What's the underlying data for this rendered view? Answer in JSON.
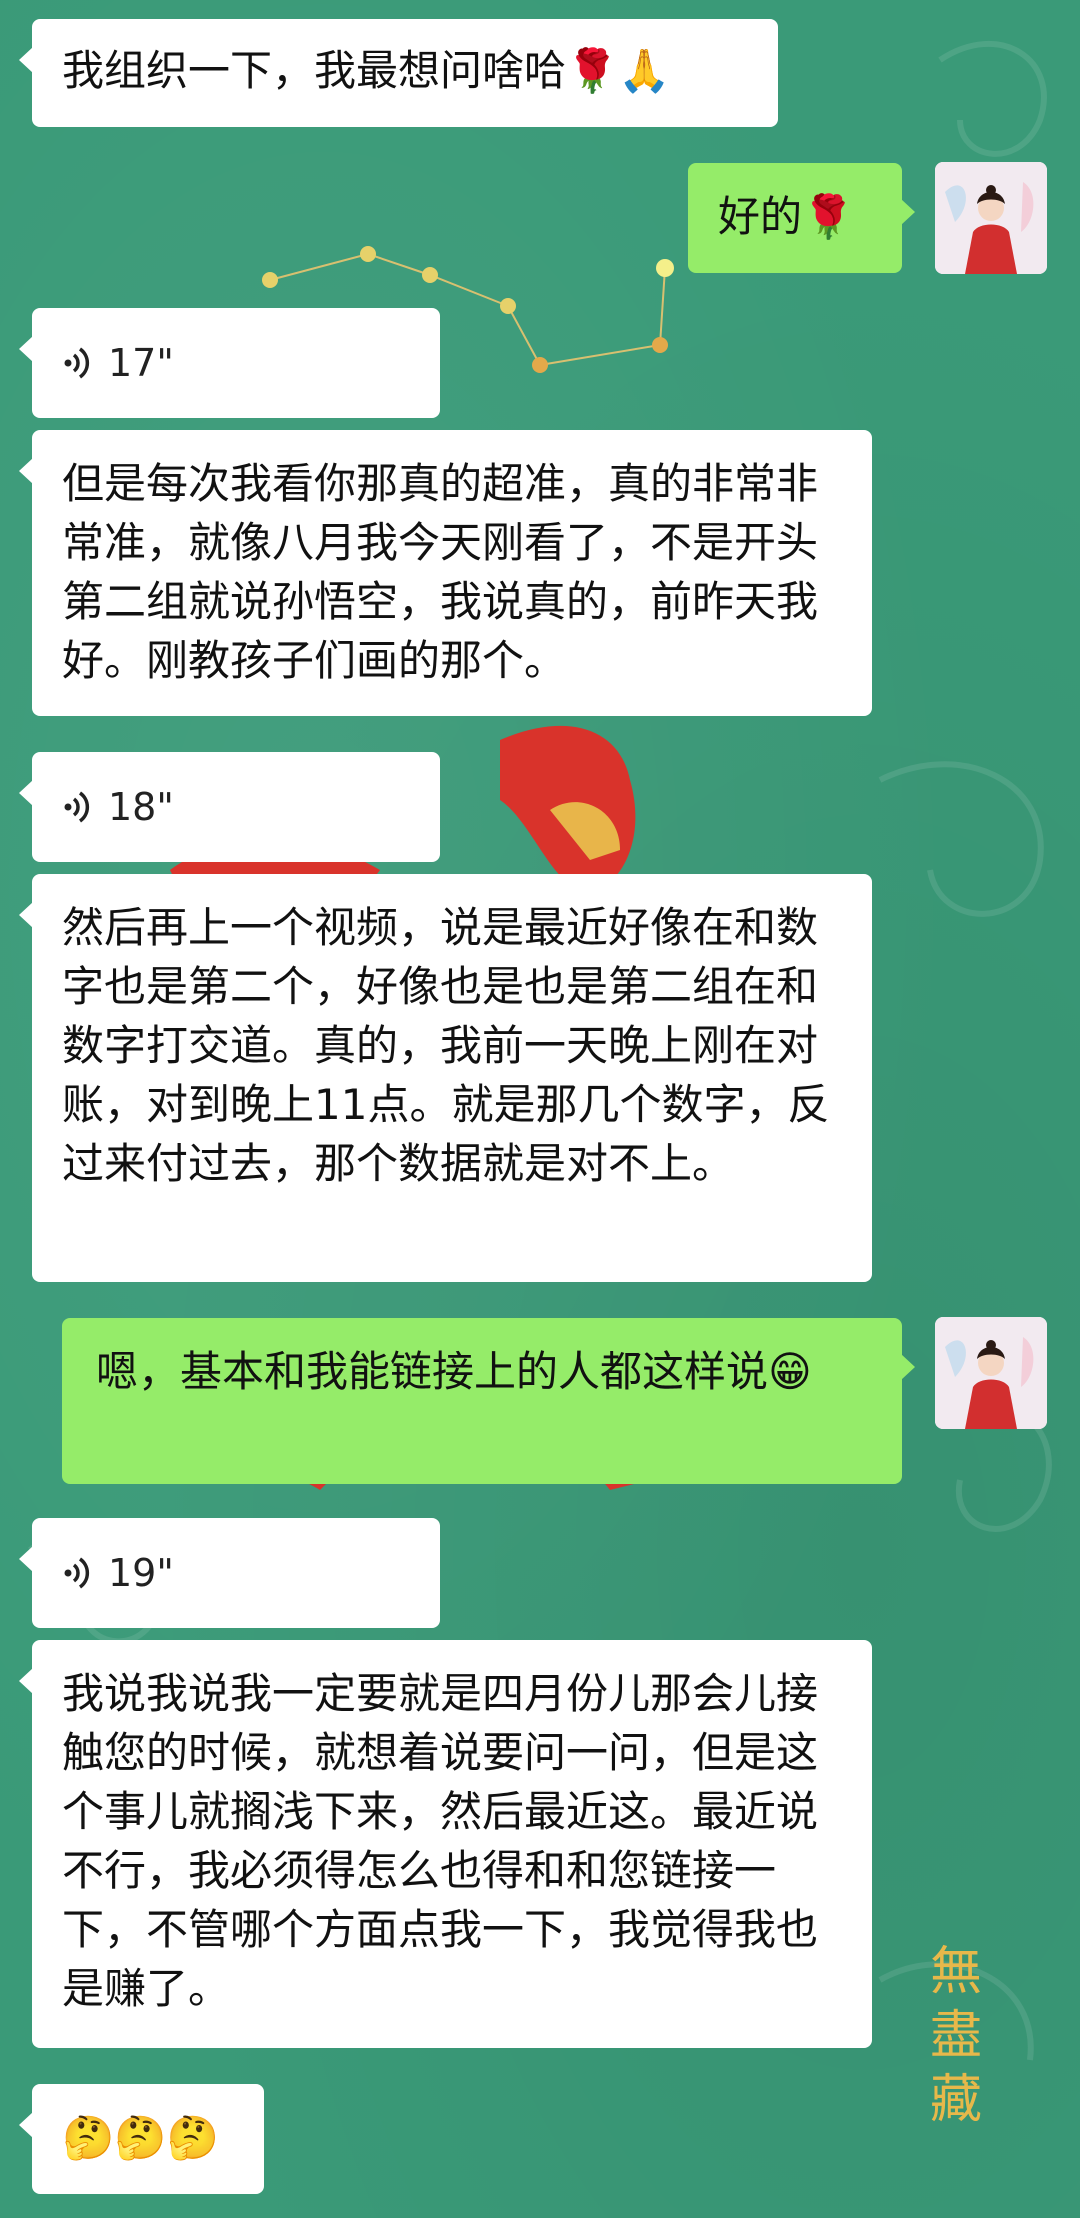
{
  "chat": {
    "messages": [
      {
        "side": "left",
        "type": "text",
        "text": "我组织一下，我最想问啥哈🌹🙏"
      },
      {
        "side": "right",
        "type": "text",
        "text": "好的🌹"
      },
      {
        "side": "left",
        "type": "voice",
        "duration": "17\""
      },
      {
        "side": "left",
        "type": "text",
        "text": "但是每次我看你那真的超准，真的非常非常准，就像八月我今天刚看了，不是开头第二组就说孙悟空，我说真的，前昨天我好。刚教孩子们画的那个。"
      },
      {
        "side": "left",
        "type": "voice",
        "duration": "18\""
      },
      {
        "side": "left",
        "type": "text",
        "text": "然后再上一个视频，说是最近好像在和数字也是第二个，好像也是也是第二组在和数字打交道。真的，我前一天晚上刚在对账，对到晚上11点。就是那几个数字，反过来付过去，那个数据就是对不上。"
      },
      {
        "side": "right",
        "type": "text",
        "text": "嗯，基本和我能链接上的人都这样说😁"
      },
      {
        "side": "left",
        "type": "voice",
        "duration": "19\""
      },
      {
        "side": "left",
        "type": "text",
        "text": "我说我说我一定要就是四月份儿那会儿接触您的时候，就想着说要问一问，但是这个事儿就搁浅下来，然后最近这。最近说不行，我必须得怎么也得和和您链接一下，不管哪个方面点我一下，我觉得我也是赚了。"
      },
      {
        "side": "left",
        "type": "text",
        "text": "🤔🤔🤔"
      }
    ]
  },
  "background": {
    "watermark_text": "無盡藏",
    "base_color": "#3a9a78"
  },
  "colors": {
    "bubble_left": "#ffffff",
    "bubble_right": "#95ec69"
  },
  "icons": {
    "voice": "voice-wave-icon",
    "avatar": "avatar-red-dress-woman"
  }
}
